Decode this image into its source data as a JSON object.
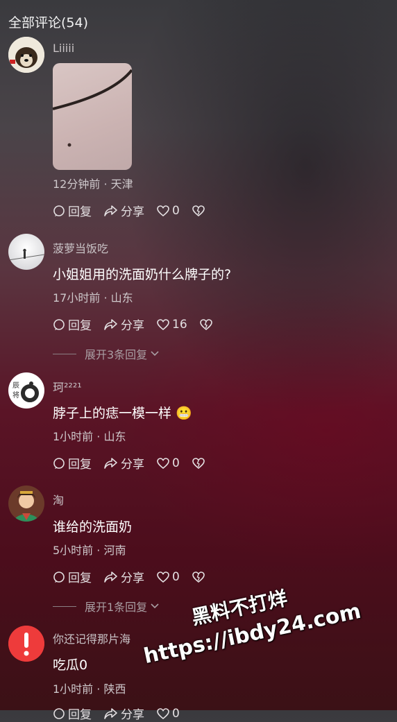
{
  "header": {
    "title": "全部评论(54)"
  },
  "comments": [
    {
      "user": "Liiiii",
      "text": "",
      "meta": "12分钟前 · 天津",
      "reply_label": "回复",
      "share_label": "分享",
      "likes": "0",
      "expand": ""
    },
    {
      "user": "菠萝当饭吃",
      "text": "小姐姐用的洗面奶什么牌子的?",
      "meta": "17小时前 · 山东",
      "reply_label": "回复",
      "share_label": "分享",
      "likes": "16",
      "expand": "展开3条回复"
    },
    {
      "user": "珂²²²¹",
      "text": "脖子上的痣一模一样 😬",
      "meta": "1小时前 · 山东",
      "reply_label": "回复",
      "share_label": "分享",
      "likes": "0",
      "expand": ""
    },
    {
      "user": "淘",
      "text": "谁给的洗面奶",
      "meta": "5小时前 · 河南",
      "reply_label": "回复",
      "share_label": "分享",
      "likes": "0",
      "expand": "展开1条回复"
    },
    {
      "user": "你还记得那片海",
      "text": "吃瓜0",
      "meta": "1小时前 · 陕西",
      "reply_label": "回复",
      "share_label": "分享",
      "likes": "0",
      "expand": ""
    }
  ],
  "watermark": {
    "line1": "黑料不打烊",
    "line2": "https://ibdy24.com"
  },
  "colors": {
    "accent_alert": "#ee3b3b",
    "text_secondary": "#cfc9cc"
  }
}
